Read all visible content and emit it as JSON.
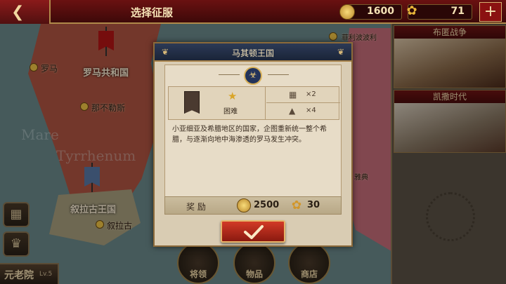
{
  "topbar": {
    "title": "选择征服",
    "coins": "1600",
    "laurels": "71",
    "plus": "+",
    "back_icon": "back-arrow-icon"
  },
  "map": {
    "sea_names": [
      "Mare",
      "Tyrrhenum"
    ],
    "labels": {
      "roma_small": "罗马",
      "roman_republic": "罗马共和国",
      "napoli": "那不勒斯",
      "syracuse_kingdom": "叙拉古王国",
      "syracuse": "叙拉古",
      "philippi": "菲利波波利",
      "athens": "雅典"
    }
  },
  "side_panel": {
    "cards": [
      {
        "title": "布匿战争"
      },
      {
        "title": "凯撒时代"
      }
    ]
  },
  "left": {
    "senate_name": "元老院",
    "senate_level": "Lv.5"
  },
  "bottom_buttons": [
    "将领",
    "物品",
    "商店"
  ],
  "modal": {
    "title": "马其顿王国",
    "difficulty": "困难",
    "stat1": "×2",
    "stat2": "×4",
    "description": "小亚细亚及希腊地区的国家，企图重新统一整个希腊，与逐渐向地中海渗透的罗马发生冲突。",
    "reward_label": "奖 励",
    "reward_coins": "2500",
    "reward_laurels": "30"
  }
}
